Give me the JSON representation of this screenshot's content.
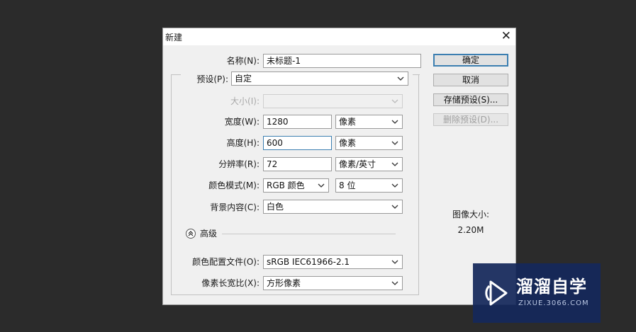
{
  "dialog": {
    "title": "新建",
    "name": {
      "label": "名称(N):",
      "value": "未标题-1"
    },
    "preset": {
      "label": "预设(P):",
      "value": "自定"
    },
    "size": {
      "label": "大小(I):",
      "value": ""
    },
    "width": {
      "label": "宽度(W):",
      "value": "1280",
      "unit": "像素"
    },
    "height": {
      "label": "高度(H):",
      "value": "600",
      "unit": "像素"
    },
    "resolution": {
      "label": "分辨率(R):",
      "value": "72",
      "unit": "像素/英寸"
    },
    "color_mode": {
      "label": "颜色模式(M):",
      "value": "RGB 颜色",
      "bits": "8 位"
    },
    "background": {
      "label": "背景内容(C):",
      "value": "白色"
    },
    "advanced": {
      "label": "高级"
    },
    "color_profile": {
      "label": "颜色配置文件(O):",
      "value": "sRGB IEC61966-2.1"
    },
    "pixel_aspect": {
      "label": "像素长宽比(X):",
      "value": "方形像素"
    },
    "buttons": {
      "ok": "确定",
      "cancel": "取消",
      "save_preset": "存储预设(S)...",
      "delete_preset": "删除预设(D)..."
    },
    "image_size": {
      "label": "图像大小:",
      "value": "2.20M"
    }
  },
  "watermark": {
    "name": "溜溜自学",
    "url": "ZIXUE.3066.COM"
  },
  "colors": {
    "accent": "#3c7fb1",
    "watermark_bg": "#14285a"
  }
}
